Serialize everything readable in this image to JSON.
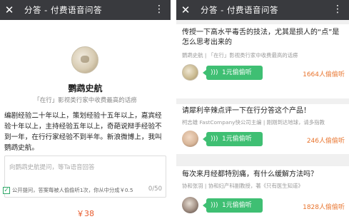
{
  "left": {
    "topbar": {
      "close_icon": "close-icon",
      "title": "分答 - 付费语音问答",
      "more_icon": "more-icon"
    },
    "profile": {
      "name": "鹦鹉史航",
      "desc": "「在行」影视类行家中收费最高的话痨",
      "bio": "编剧经验二十年以上，策划经验十五年以上，嘉宾经验十年以上，主持经验五年以上，奇葩说辩手经验不到一年，在行行家经验不到半年。新浪微博上，我叫鹦鹉史航。"
    },
    "question_box": {
      "placeholder": "向鹦鹉史航提问，等Ta语音回答",
      "counter": "0/50"
    },
    "public": {
      "checked": true,
      "text": "公开提问，答案每被人偷偷听1次，你从中分成￥0.5"
    },
    "price": "￥38"
  },
  "right": {
    "topbar": {
      "close_icon": "close-icon",
      "title": "分答 - 付费语音问答",
      "more_icon": "more-icon"
    },
    "items": [
      {
        "question": "传授一下高水平毒舌的技法，尤其是损人的“点”是怎么思考出来的",
        "meta": "鹦鹉史航 | 「在行」影视类行家中收费最高的话痨",
        "button": "1元偷偷听",
        "listeners": "1664人偷偷听",
        "avatar_color": "#c9b990"
      },
      {
        "question": "请犀利辛辣点评一下在行分答这个产品！",
        "meta": "柯志雄 FastCompany快公司主编 | 刚刚到达地球，请多指教",
        "button": "1元偷偷听",
        "listeners": "246人偷偷听",
        "avatar_color": "#d9b79a"
      },
      {
        "question": "每次来月经都特别痛，有什么缓解方法吗？",
        "meta": "协和张羽 | 协和妇产科副教授，著《只有医生知道》",
        "button": "1元偷偷听",
        "listeners": "1828人偷偷听",
        "avatar_color": "#7a6a5c"
      }
    ]
  },
  "colors": {
    "topbar": "#393a3e",
    "accent_green": "#3fbf73",
    "orange": "#e8732c",
    "price_red": "#e85a2c"
  }
}
